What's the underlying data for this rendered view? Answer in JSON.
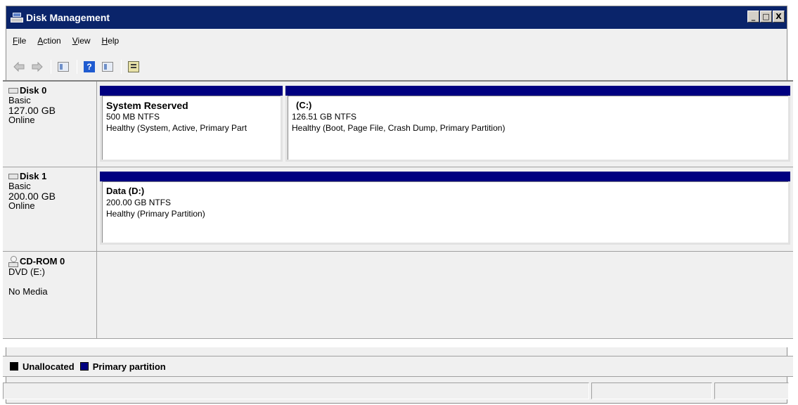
{
  "window": {
    "title": "Disk Management",
    "minimize_label": "_",
    "maximize_label": "□",
    "close_label": "X"
  },
  "menu": {
    "items": [
      {
        "accel": "F",
        "rest": "ile"
      },
      {
        "accel": "A",
        "rest": "ction"
      },
      {
        "accel": "V",
        "rest": "iew"
      },
      {
        "accel": "H",
        "rest": "elp"
      }
    ]
  },
  "toolbar": {
    "back_icon": "back-arrow-icon",
    "forward_icon": "forward-arrow-icon",
    "help_label": "?"
  },
  "disks": [
    {
      "name": "Disk 0",
      "type": "Basic",
      "size": "127.00 GB",
      "status": "Online",
      "partitions": [
        {
          "name": "System Reserved",
          "size_fs": "500 MB NTFS",
          "health": "Healthy (System, Active, Primary Part"
        },
        {
          "name": "(C:)",
          "size_fs": "126.51 GB NTFS",
          "health": "Healthy (Boot, Page File, Crash Dump, Primary Partition)"
        }
      ]
    },
    {
      "name": "Disk 1",
      "type": "Basic",
      "size": "200.00 GB",
      "status": "Online",
      "partitions": [
        {
          "name": "Data (D:)",
          "size_fs": "200.00 GB NTFS",
          "health": "Healthy (Primary Partition)"
        }
      ]
    }
  ],
  "cdrom": {
    "name": "CD-ROM 0",
    "drive": "DVD (E:)",
    "status": "No Media"
  },
  "legend": {
    "items": [
      {
        "label": "Unallocated",
        "color": "#000000"
      },
      {
        "label": "Primary partition",
        "color": "#000080"
      }
    ]
  }
}
